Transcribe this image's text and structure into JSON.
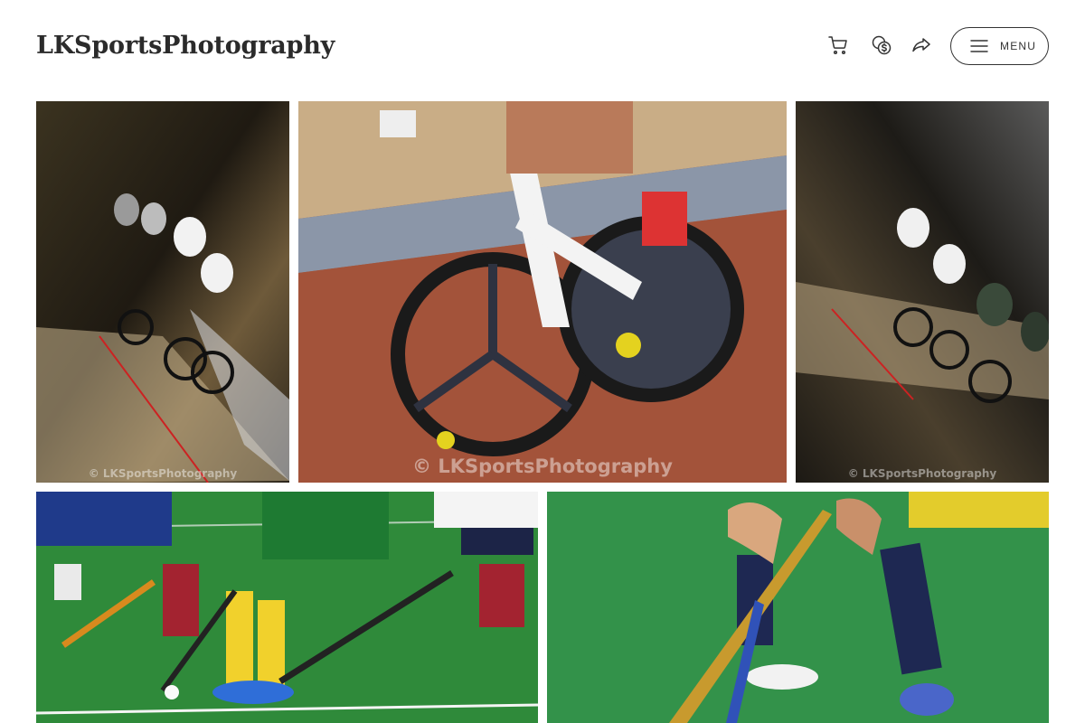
{
  "brand": {
    "name": "LKSportsPhotography"
  },
  "header": {
    "icons": [
      "cart-icon",
      "currency-icon",
      "share-icon"
    ],
    "menu_label": "MENU"
  },
  "gallery": {
    "photos": [
      {
        "subject": "track-cycling-team-pursuit",
        "watermark": "© LKSportsPhotography"
      },
      {
        "subject": "track-cycling-wheel-closeup",
        "watermark": "© LKSportsPhotography"
      },
      {
        "subject": "track-cycling-team-pursuit",
        "watermark": "© LKSportsPhotography"
      },
      {
        "subject": "field-hockey-players"
      },
      {
        "subject": "field-hockey-stick-closeup"
      }
    ]
  },
  "colors": {
    "text": "#2b2b2b",
    "turf": "#2f8a3a",
    "track": "#9c4f38"
  }
}
